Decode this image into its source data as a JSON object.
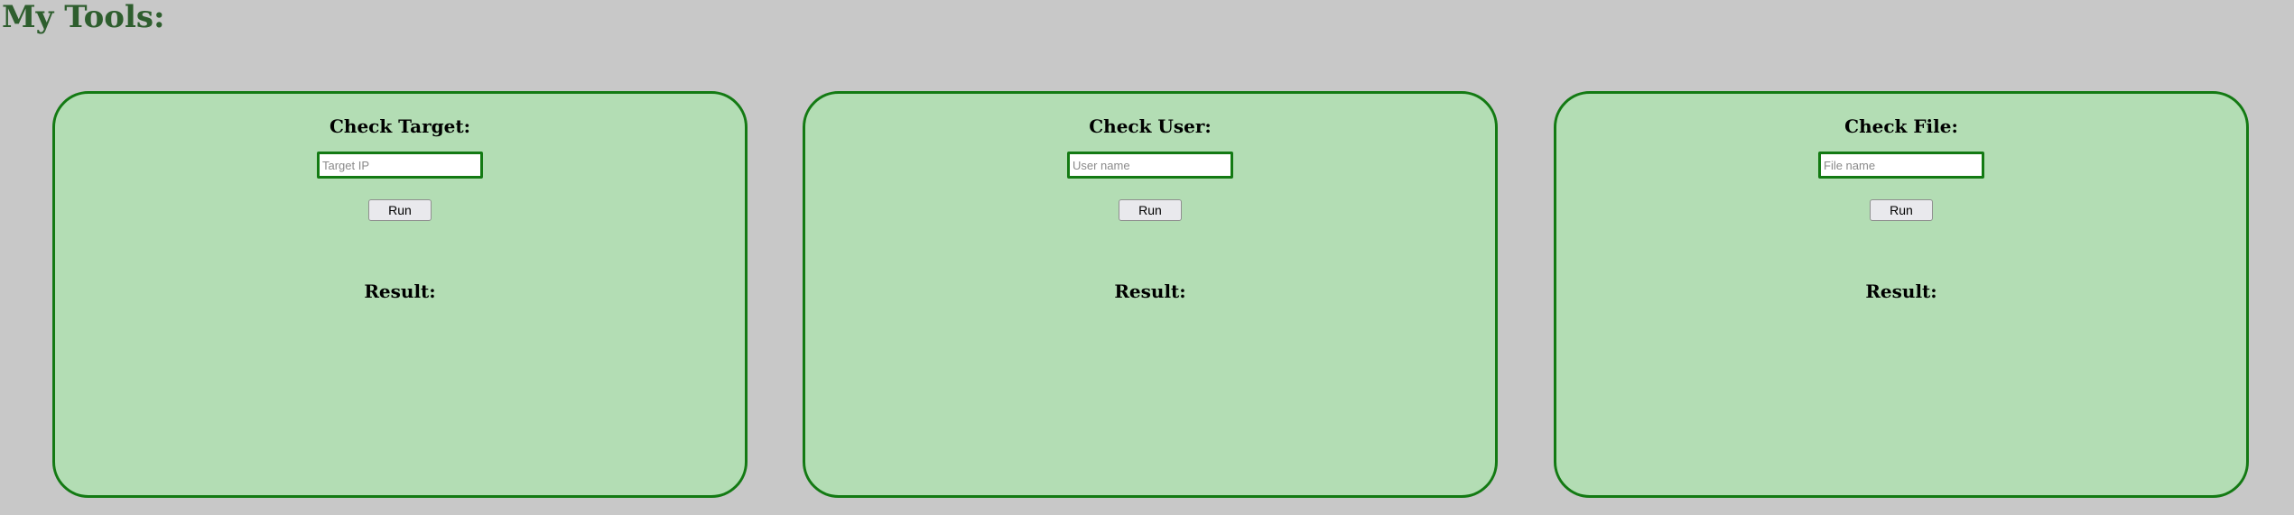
{
  "page": {
    "title": "My Tools:"
  },
  "cards": [
    {
      "title": "Check Target:",
      "input_placeholder": "Target IP",
      "input_value": "",
      "button_label": "Run",
      "result_label": "Result:"
    },
    {
      "title": "Check User:",
      "input_placeholder": "User name",
      "input_value": "",
      "button_label": "Run",
      "result_label": "Result:"
    },
    {
      "title": "Check File:",
      "input_placeholder": "File name",
      "input_value": "",
      "button_label": "Run",
      "result_label": "Result:"
    }
  ],
  "colors": {
    "page_background": "#c8c8c8",
    "title_text": "#2e5e2e",
    "card_background": "#b3ddb4",
    "card_border": "#137a13",
    "input_border": "#137a13"
  }
}
